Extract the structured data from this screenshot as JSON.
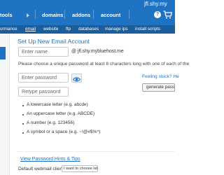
{
  "header": {
    "domain": "jfl.shy.my",
    "nav": [
      "tools",
      "domains",
      "addons",
      "account"
    ],
    "help_icon_glyph": "?",
    "cart_icon": "cart-icon"
  },
  "subnav": {
    "items": [
      "ormance",
      "email",
      "website",
      "ftp",
      "databases",
      "manage ips",
      "install scripts"
    ],
    "active": "email"
  },
  "form": {
    "title": "Set Up New Email Account",
    "name_placeholder": "Enter name",
    "domain_suffix": "@ jfl.shy.mybluehost.me",
    "password_notice": "Please choose a unique password at least 8 characters long with one of each of the",
    "password_placeholder": "Enter password",
    "retype_placeholder": "Retype password",
    "feeling_stuck": "Feeling stuck? He",
    "generate_button": "generate passw",
    "requirements": [
      "A lowercase letter (e.g. abcde)",
      "An uppercase letter (e.g. ABCDE)",
      "A number (e.g. 123456)",
      "A symbol or a space (e.g. ~!@#$%^)"
    ],
    "hints_link": "View Password Hints & Tips",
    "webmail_label": "Default webmail client",
    "webmail_value": "I want to choose later"
  },
  "colors": {
    "brand_blue": "#1f73c3",
    "subnav_blue": "#1a5e9e"
  }
}
